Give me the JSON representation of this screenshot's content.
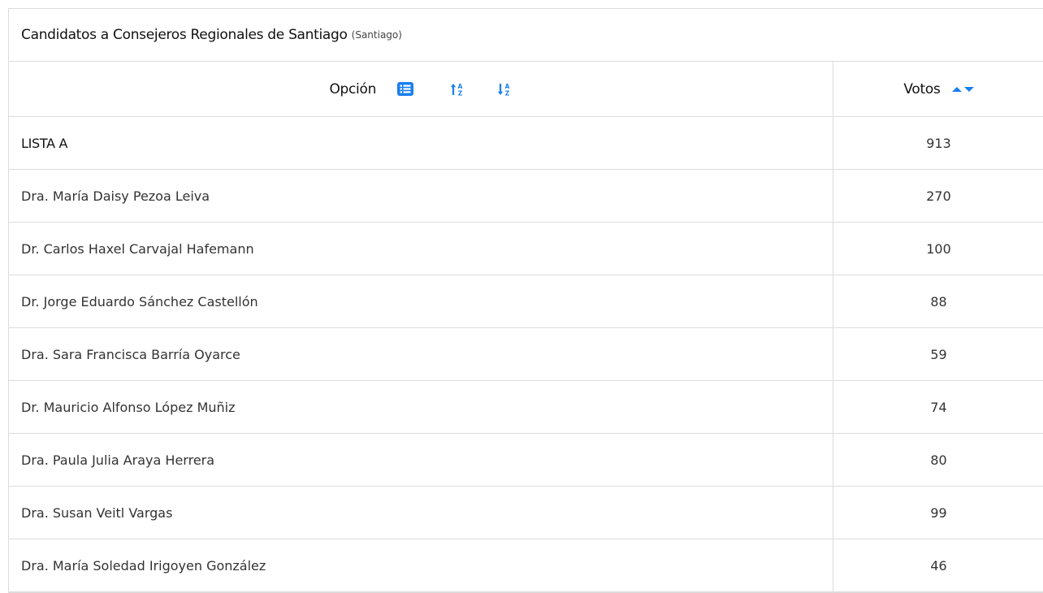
{
  "panel": {
    "title": "Candidatos a Consejeros Regionales de Santiago",
    "subtitle": "(Santiago)"
  },
  "table": {
    "headers": {
      "option": "Opción",
      "votes": "Votos"
    },
    "icons": {
      "list": "list-icon",
      "sort_asc": "sort-alpha-asc-icon",
      "sort_desc": "sort-alpha-desc-icon",
      "votes_up": "caret-up-icon",
      "votes_down": "caret-down-icon"
    },
    "accent_color": "#1a7ff0",
    "rows": [
      {
        "option": "LISTA A",
        "votes": "913",
        "is_list": true
      },
      {
        "option": "Dra. María Daisy Pezoa Leiva",
        "votes": "270"
      },
      {
        "option": "Dr. Carlos Haxel Carvajal Hafemann",
        "votes": "100"
      },
      {
        "option": "Dr. Jorge Eduardo Sánchez Castellón",
        "votes": "88"
      },
      {
        "option": "Dra. Sara Francisca Barría Oyarce",
        "votes": "59"
      },
      {
        "option": "Dr. Mauricio Alfonso López Muñiz",
        "votes": "74"
      },
      {
        "option": "Dra. Paula Julia Araya Herrera",
        "votes": "80"
      },
      {
        "option": "Dra. Susan Veitl Vargas",
        "votes": "99"
      },
      {
        "option": "Dra. María Soledad Irigoyen González",
        "votes": "46"
      }
    ]
  }
}
